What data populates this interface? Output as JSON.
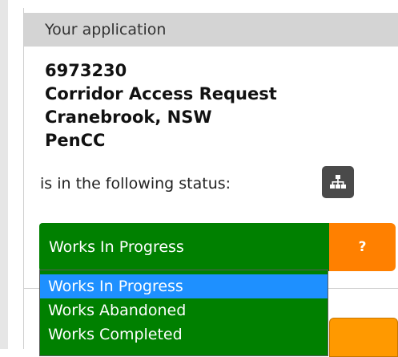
{
  "panel": {
    "header_title": "Your application"
  },
  "application": {
    "id": "6973230",
    "type": "Corridor Access Request",
    "location": "Cranebrook, NSW",
    "organisation": "PenCC"
  },
  "status": {
    "prompt": "is in the following status:",
    "tree_icon": "sitemap-icon",
    "current": "Works In Progress",
    "help_label": "?",
    "options": [
      "Works In Progress",
      "Works Abandoned",
      "Works Completed"
    ]
  },
  "colors": {
    "header_bg": "#d4d4d4",
    "select_green": "#008000",
    "highlight_blue": "#1e90ff",
    "help_orange": "#ff8000",
    "tree_button_bg": "#4a4a4a"
  }
}
